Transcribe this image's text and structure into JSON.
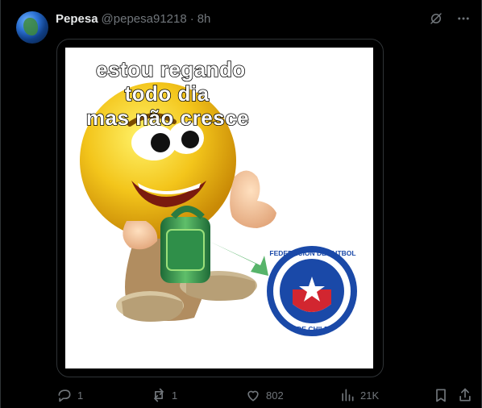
{
  "post": {
    "author_name": "Pepesa",
    "author_handle": "@pepesa91218",
    "separator": "·",
    "timestamp": "8h",
    "meme_lines": [
      "estou regando",
      "todo dia",
      "mas não cresce"
    ],
    "badge_text_top": "FEDERACION DE FUTBOL",
    "badge_text_bottom": "DE CHILE"
  },
  "actions": {
    "replies": "1",
    "reposts": "1",
    "likes": "802",
    "views": "21K"
  },
  "colors": {
    "background": "#000000",
    "text": "#e7e9ea",
    "muted": "#71767b",
    "border": "#2f3336",
    "chile_blue": "#1a49a8",
    "chile_red": "#d22630"
  },
  "icons": [
    "avatar-earth",
    "grok-icon",
    "more-icon",
    "reply-icon",
    "repost-icon",
    "like-icon",
    "views-icon",
    "bookmark-icon",
    "share-icon"
  ]
}
